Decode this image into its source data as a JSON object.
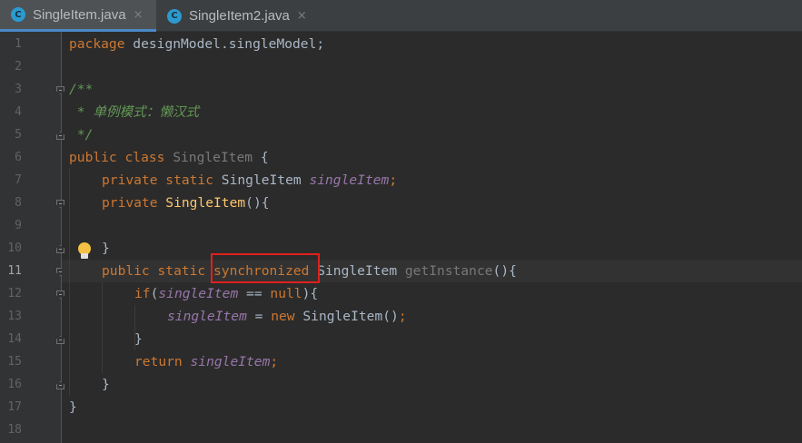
{
  "tabs": [
    {
      "label": "SingleItem.java",
      "icon": "java-class-icon",
      "active": true
    },
    {
      "label": "SingleItem2.java",
      "icon": "java-class-icon",
      "active": false
    }
  ],
  "tab_icon_letter": "C",
  "close_glyph": "×",
  "current_line": 11,
  "line_numbers": [
    "1",
    "2",
    "3",
    "4",
    "5",
    "6",
    "7",
    "8",
    "9",
    "10",
    "11",
    "12",
    "13",
    "14",
    "15",
    "16",
    "17",
    "18"
  ],
  "code": {
    "l1": {
      "kw": "package",
      "rest": " designModel.singleModel;"
    },
    "l3": "/**",
    "l4": " * 单例模式：懒汉式",
    "l5": " */",
    "l6": {
      "kw": "public class",
      "cls": " SingleItem",
      "rest": " {"
    },
    "l7": {
      "kw": "private static",
      "type": " SingleItem ",
      "field": "singleItem",
      "semi": ";"
    },
    "l8": {
      "kw": "private",
      "ctor": " SingleItem",
      "rest": "(){"
    },
    "l10": "}",
    "l11": {
      "kw": "public static ",
      "sync": "synchronized",
      "type": " SingleItem ",
      "method": "getInstance",
      "rest": "(){"
    },
    "l12": {
      "kw": "if",
      "open": "(",
      "field": "singleItem",
      "op": " == ",
      "null": "null",
      "rest": "){"
    },
    "l13": {
      "field": "singleItem",
      "op": " = ",
      "kw": "new",
      "rest": " SingleItem()",
      "semi": ";"
    },
    "l14": "}",
    "l15": {
      "kw": "return",
      "sp": " ",
      "field": "singleItem",
      "semi": ";"
    },
    "l16": "}",
    "l17": "}"
  },
  "colors": {
    "background": "#2b2b2b",
    "keyword": "#cc7832",
    "comment": "#629755",
    "field": "#9876aa",
    "method": "#ffc66d",
    "highlight_box": "#e0201c"
  }
}
